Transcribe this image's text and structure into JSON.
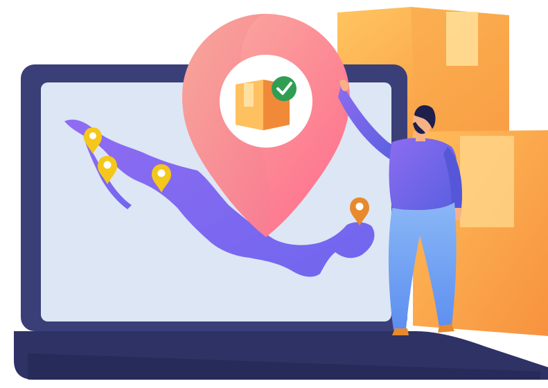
{
  "illustration": {
    "subject": "laptop-map-delivery-scene",
    "icons": [
      "laptop",
      "map-of-mexico",
      "location-pin",
      "package-box",
      "check-badge",
      "person-pointing",
      "cardboard-boxes"
    ],
    "pins": [
      {
        "icon": "location-pin",
        "color": "#f5c71a"
      },
      {
        "icon": "location-pin",
        "color": "#f5c71a"
      },
      {
        "icon": "location-pin",
        "color": "#f5c71a"
      },
      {
        "icon": "location-pin",
        "color": "#e8892e"
      }
    ],
    "colors": {
      "laptop_frame": "#3a3f78",
      "laptop_base": "#2e3265",
      "screen": "#dde6f5",
      "map": "#8563f0",
      "big_pin_start": "#f9a89c",
      "big_pin_end": "#ff6d8f",
      "check_badge": "#2f9e53",
      "box_light": "#ffc35e",
      "box_dark": "#f59a3e",
      "person_shirt": "#6b66e8",
      "person_pants": "#6fa6f2",
      "person_hair": "#1e1f4a"
    }
  }
}
